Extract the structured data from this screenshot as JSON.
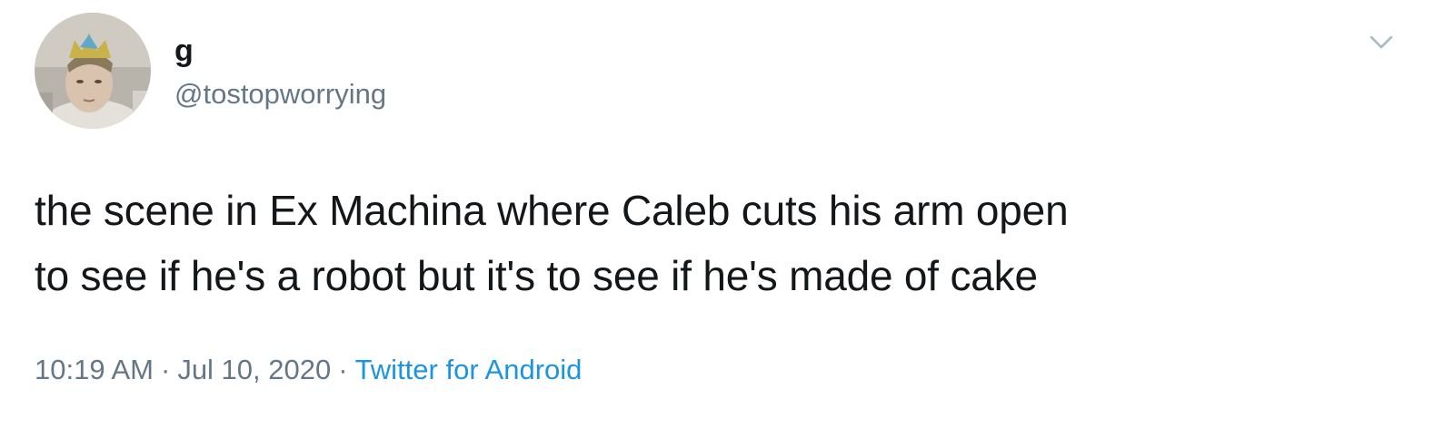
{
  "tweet": {
    "author": {
      "display_name": "g",
      "handle": "@tostopworrying"
    },
    "text_lines": [
      "the scene in Ex Machina where Caleb cuts his arm open",
      "to see if he's a robot but it's to see if he's made of cake"
    ],
    "time": "10:19 AM",
    "date": "Jul 10, 2020",
    "separator": "·",
    "source": "Twitter for Android"
  },
  "icons": {
    "avatar": "profile-photo",
    "menu": "chevron-down-icon"
  },
  "colors": {
    "text": "#14171a",
    "secondary": "#657786",
    "link": "#1b95e0",
    "background": "#ffffff"
  }
}
